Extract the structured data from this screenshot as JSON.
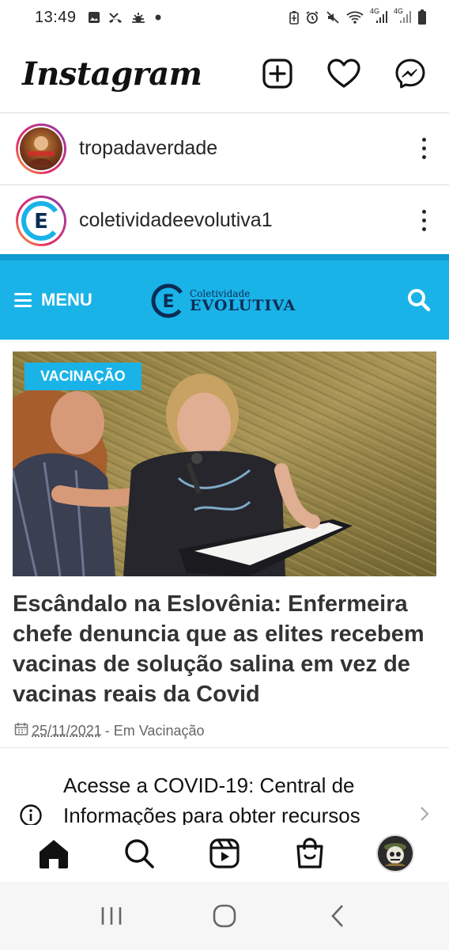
{
  "status_bar": {
    "time": "13:49",
    "left_icons": [
      "image-icon",
      "missed-call-icon",
      "weather-icon",
      "dot-icon"
    ],
    "right_icons": [
      "battery-saver-icon",
      "alarm-icon",
      "mute-icon",
      "wifi-icon",
      "signal-4g-icon",
      "signal-4g-icon",
      "battery-icon"
    ],
    "net_label_1": "4G",
    "net_label_2": "4G"
  },
  "ig_header": {
    "logo": "Instagram",
    "actions": [
      "add-post-icon",
      "heart-icon",
      "messenger-icon"
    ]
  },
  "accounts": [
    {
      "username": "tropadaverdade"
    },
    {
      "username": "coletividadeevolutiva1"
    }
  ],
  "site": {
    "menu_label": "MENU",
    "logo_small": "Coletividade",
    "logo_big": "EVOLUTIVA",
    "logo_letter": "E",
    "accent_color": "#1ab3e8"
  },
  "article": {
    "category": "VACINAÇÃO",
    "headline": "Escândalo na Eslovênia: Enfermeira chefe denuncia que as elites recebem vacinas de solução salina em vez de vacinas reais da Covid",
    "date": "25/11/2021",
    "meta_suffix": "- Em Vacinação"
  },
  "covid_card": {
    "text": "Acesse a COVID-19: Central de Informações para obter recursos"
  },
  "bottom_nav": [
    "home-icon",
    "search-icon",
    "reels-icon",
    "shop-icon",
    "profile-avatar"
  ]
}
